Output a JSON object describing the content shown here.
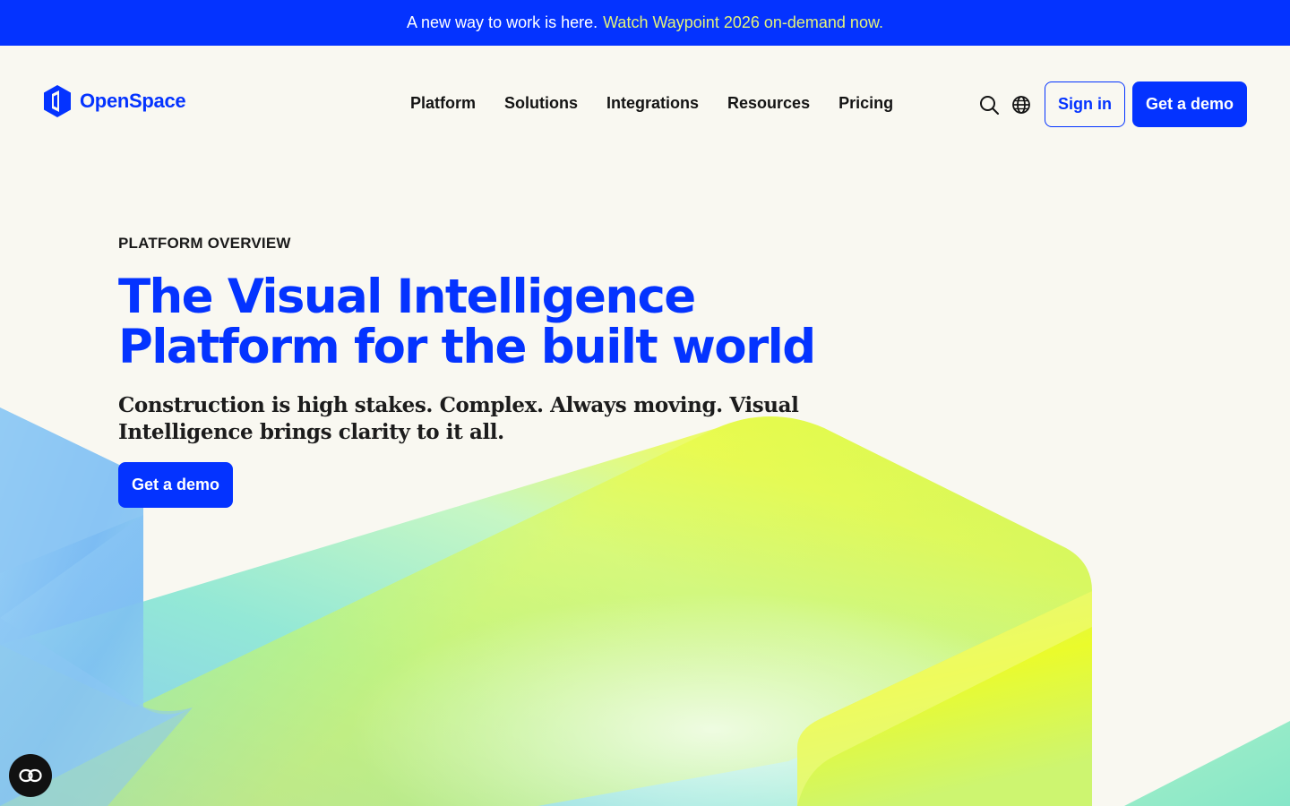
{
  "announcement": {
    "text": "A new way to work is here.",
    "link_text": "Watch Waypoint 2026 on-demand now."
  },
  "header": {
    "logo_text": "OpenSpace",
    "nav": [
      {
        "label": "Platform"
      },
      {
        "label": "Solutions"
      },
      {
        "label": "Integrations"
      },
      {
        "label": "Resources"
      },
      {
        "label": "Pricing"
      }
    ],
    "icons": {
      "search": "search-icon",
      "language": "globe-icon"
    },
    "sign_in_label": "Sign in",
    "demo_label": "Get a demo"
  },
  "hero": {
    "eyebrow": "PLATFORM OVERVIEW",
    "title_line1": "The Visual Intelligence",
    "title_line2": "Platform for the built world",
    "subtitle": "Construction is high stakes. Complex. Always moving. Visual Intelligence brings clarity to it all.",
    "cta_label": "Get a demo"
  },
  "floating": {
    "a11y_icon": "accessibility-icon"
  },
  "colors": {
    "brand_blue": "#0433ff",
    "page_bg": "#f9f8f1",
    "announcement_link": "#e3f27a",
    "gradient_green": "#8ef0b0",
    "gradient_yellow": "#eafb2c",
    "gradient_sky": "#8fd0f5"
  }
}
